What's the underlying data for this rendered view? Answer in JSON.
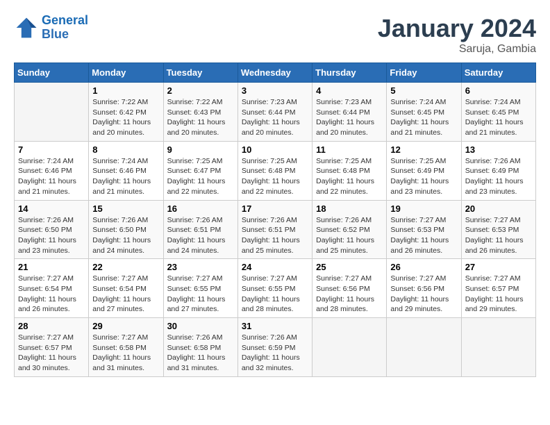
{
  "header": {
    "logo_line1": "General",
    "logo_line2": "Blue",
    "title": "January 2024",
    "subtitle": "Saruja, Gambia"
  },
  "weekdays": [
    "Sunday",
    "Monday",
    "Tuesday",
    "Wednesday",
    "Thursday",
    "Friday",
    "Saturday"
  ],
  "weeks": [
    [
      {
        "day": "",
        "info": ""
      },
      {
        "day": "1",
        "info": "Sunrise: 7:22 AM\nSunset: 6:42 PM\nDaylight: 11 hours\nand 20 minutes."
      },
      {
        "day": "2",
        "info": "Sunrise: 7:22 AM\nSunset: 6:43 PM\nDaylight: 11 hours\nand 20 minutes."
      },
      {
        "day": "3",
        "info": "Sunrise: 7:23 AM\nSunset: 6:44 PM\nDaylight: 11 hours\nand 20 minutes."
      },
      {
        "day": "4",
        "info": "Sunrise: 7:23 AM\nSunset: 6:44 PM\nDaylight: 11 hours\nand 20 minutes."
      },
      {
        "day": "5",
        "info": "Sunrise: 7:24 AM\nSunset: 6:45 PM\nDaylight: 11 hours\nand 21 minutes."
      },
      {
        "day": "6",
        "info": "Sunrise: 7:24 AM\nSunset: 6:45 PM\nDaylight: 11 hours\nand 21 minutes."
      }
    ],
    [
      {
        "day": "7",
        "info": "Sunrise: 7:24 AM\nSunset: 6:46 PM\nDaylight: 11 hours\nand 21 minutes."
      },
      {
        "day": "8",
        "info": "Sunrise: 7:24 AM\nSunset: 6:46 PM\nDaylight: 11 hours\nand 21 minutes."
      },
      {
        "day": "9",
        "info": "Sunrise: 7:25 AM\nSunset: 6:47 PM\nDaylight: 11 hours\nand 22 minutes."
      },
      {
        "day": "10",
        "info": "Sunrise: 7:25 AM\nSunset: 6:48 PM\nDaylight: 11 hours\nand 22 minutes."
      },
      {
        "day": "11",
        "info": "Sunrise: 7:25 AM\nSunset: 6:48 PM\nDaylight: 11 hours\nand 22 minutes."
      },
      {
        "day": "12",
        "info": "Sunrise: 7:25 AM\nSunset: 6:49 PM\nDaylight: 11 hours\nand 23 minutes."
      },
      {
        "day": "13",
        "info": "Sunrise: 7:26 AM\nSunset: 6:49 PM\nDaylight: 11 hours\nand 23 minutes."
      }
    ],
    [
      {
        "day": "14",
        "info": "Sunrise: 7:26 AM\nSunset: 6:50 PM\nDaylight: 11 hours\nand 23 minutes."
      },
      {
        "day": "15",
        "info": "Sunrise: 7:26 AM\nSunset: 6:50 PM\nDaylight: 11 hours\nand 24 minutes."
      },
      {
        "day": "16",
        "info": "Sunrise: 7:26 AM\nSunset: 6:51 PM\nDaylight: 11 hours\nand 24 minutes."
      },
      {
        "day": "17",
        "info": "Sunrise: 7:26 AM\nSunset: 6:51 PM\nDaylight: 11 hours\nand 25 minutes."
      },
      {
        "day": "18",
        "info": "Sunrise: 7:26 AM\nSunset: 6:52 PM\nDaylight: 11 hours\nand 25 minutes."
      },
      {
        "day": "19",
        "info": "Sunrise: 7:27 AM\nSunset: 6:53 PM\nDaylight: 11 hours\nand 26 minutes."
      },
      {
        "day": "20",
        "info": "Sunrise: 7:27 AM\nSunset: 6:53 PM\nDaylight: 11 hours\nand 26 minutes."
      }
    ],
    [
      {
        "day": "21",
        "info": "Sunrise: 7:27 AM\nSunset: 6:54 PM\nDaylight: 11 hours\nand 26 minutes."
      },
      {
        "day": "22",
        "info": "Sunrise: 7:27 AM\nSunset: 6:54 PM\nDaylight: 11 hours\nand 27 minutes."
      },
      {
        "day": "23",
        "info": "Sunrise: 7:27 AM\nSunset: 6:55 PM\nDaylight: 11 hours\nand 27 minutes."
      },
      {
        "day": "24",
        "info": "Sunrise: 7:27 AM\nSunset: 6:55 PM\nDaylight: 11 hours\nand 28 minutes."
      },
      {
        "day": "25",
        "info": "Sunrise: 7:27 AM\nSunset: 6:56 PM\nDaylight: 11 hours\nand 28 minutes."
      },
      {
        "day": "26",
        "info": "Sunrise: 7:27 AM\nSunset: 6:56 PM\nDaylight: 11 hours\nand 29 minutes."
      },
      {
        "day": "27",
        "info": "Sunrise: 7:27 AM\nSunset: 6:57 PM\nDaylight: 11 hours\nand 29 minutes."
      }
    ],
    [
      {
        "day": "28",
        "info": "Sunrise: 7:27 AM\nSunset: 6:57 PM\nDaylight: 11 hours\nand 30 minutes."
      },
      {
        "day": "29",
        "info": "Sunrise: 7:27 AM\nSunset: 6:58 PM\nDaylight: 11 hours\nand 31 minutes."
      },
      {
        "day": "30",
        "info": "Sunrise: 7:26 AM\nSunset: 6:58 PM\nDaylight: 11 hours\nand 31 minutes."
      },
      {
        "day": "31",
        "info": "Sunrise: 7:26 AM\nSunset: 6:59 PM\nDaylight: 11 hours\nand 32 minutes."
      },
      {
        "day": "",
        "info": ""
      },
      {
        "day": "",
        "info": ""
      },
      {
        "day": "",
        "info": ""
      }
    ]
  ]
}
